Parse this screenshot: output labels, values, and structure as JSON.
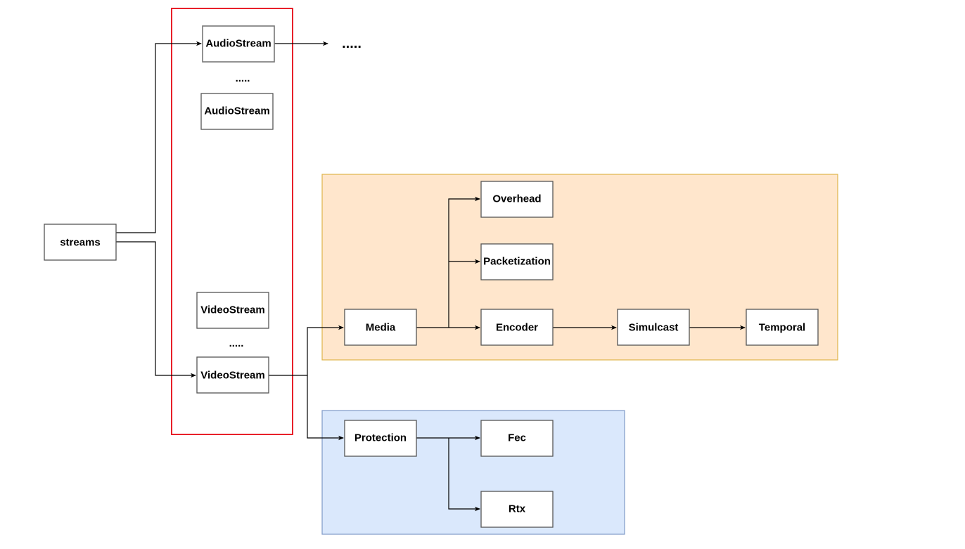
{
  "colors": {
    "group_highlight_stroke": "#e8202a",
    "media_group_fill": "#ffe6cc",
    "media_group_stroke": "#e0b34a",
    "protection_group_fill": "#dae8fc",
    "protection_group_stroke": "#7f9ac8"
  },
  "nodes": {
    "streams": "streams",
    "audio_stream_1": "AudioStream",
    "audio_stream_2": "AudioStream",
    "video_stream_1": "VideoStream",
    "video_stream_2": "VideoStream",
    "media": "Media",
    "overhead": "Overhead",
    "packetization": "Packetization",
    "encoder": "Encoder",
    "simulcast": "Simulcast",
    "temporal": "Temporal",
    "protection": "Protection",
    "fec": "Fec",
    "rtx": "Rtx"
  },
  "ellipses": {
    "audio_more": ".....",
    "video_more": ".....",
    "audio_next": "....."
  }
}
